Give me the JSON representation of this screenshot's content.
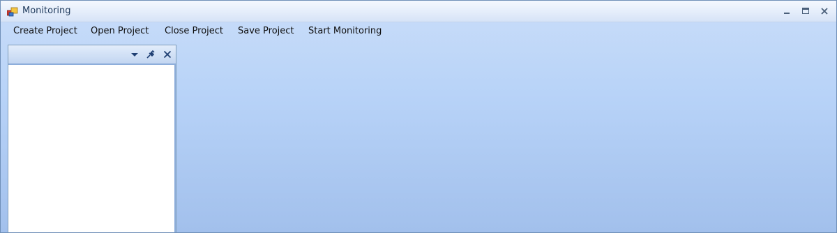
{
  "window": {
    "title": "Monitoring",
    "app_icon": "app-icon",
    "controls": [
      "minimize-icon",
      "maximize-icon",
      "close-icon"
    ]
  },
  "menu": {
    "items": [
      {
        "label": "Create Project"
      },
      {
        "label": "Open Project"
      },
      {
        "label": "Close Project"
      },
      {
        "label": "Save Project"
      },
      {
        "label": "Start Monitoring"
      }
    ]
  },
  "dock_panel": {
    "header_icons": [
      "dropdown-arrow-icon",
      "pin-icon",
      "close-icon"
    ]
  },
  "colors": {
    "workspace_top": "#c9ddf9",
    "workspace_bottom": "#a2c0ec",
    "title_text": "#1e395b"
  }
}
